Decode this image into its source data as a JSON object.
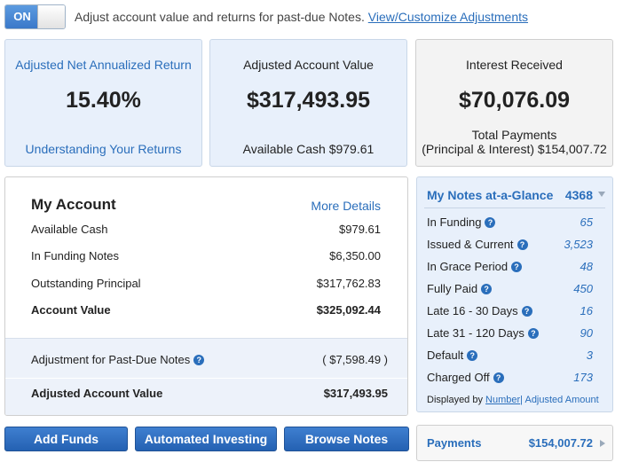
{
  "toggle": {
    "state_label": "ON"
  },
  "adjust_text": "Adjust account value and returns for past-due Notes.",
  "adjust_link": "View/Customize Adjustments",
  "kpis": {
    "return": {
      "label": "Adjusted Net Annualized Return",
      "value": "15.40%",
      "link": "Understanding Your Returns"
    },
    "account_value": {
      "label": "Adjusted Account Value",
      "value": "$317,493.95",
      "sub": "Available Cash $979.61"
    },
    "interest": {
      "label": "Interest Received",
      "value": "$70,076.09",
      "sub1": "Total Payments",
      "sub2": "(Principal & Interest) $154,007.72"
    }
  },
  "account": {
    "title": "My Account",
    "more_details": "More Details",
    "rows": [
      {
        "label": "Available Cash",
        "value": "$979.61"
      },
      {
        "label": "In Funding Notes",
        "value": "$6,350.00"
      },
      {
        "label": "Outstanding Principal",
        "value": "$317,762.83"
      },
      {
        "label": "Account Value",
        "value": "$325,092.44"
      }
    ],
    "adjustment_label": "Adjustment for Past-Due Notes",
    "adjustment_value": "( $7,598.49 )",
    "adjusted_label": "Adjusted Account Value",
    "adjusted_value": "$317,493.95"
  },
  "buttons": {
    "add_funds": "Add Funds",
    "automated_investing": "Automated Investing",
    "browse_notes": "Browse Notes"
  },
  "notes": {
    "title": "My Notes at-a-Glance",
    "count": "4368",
    "rows": [
      {
        "label": "In Funding",
        "value": "65"
      },
      {
        "label": "Issued & Current",
        "value": "3,523"
      },
      {
        "label": "In Grace Period",
        "value": "48"
      },
      {
        "label": "Fully Paid",
        "value": "450"
      },
      {
        "label": "Late 16 - 30 Days",
        "value": "16"
      },
      {
        "label": "Late 31 - 120 Days",
        "value": "90"
      },
      {
        "label": "Default",
        "value": "3"
      },
      {
        "label": "Charged Off",
        "value": "173"
      }
    ],
    "displayed_by": "Displayed by",
    "by_number": "Number",
    "by_adjusted": "| Adjusted Amount"
  },
  "payments": {
    "label": "Payments",
    "value": "$154,007.72"
  },
  "icons": {
    "help": "question-circle-icon",
    "count_caret": "caret-down-icon",
    "payments_caret": "caret-right-icon"
  },
  "colors": {
    "accent": "#2a6ebb",
    "button": "#2f6fc2",
    "panel_blue": "#e8f0fb"
  }
}
